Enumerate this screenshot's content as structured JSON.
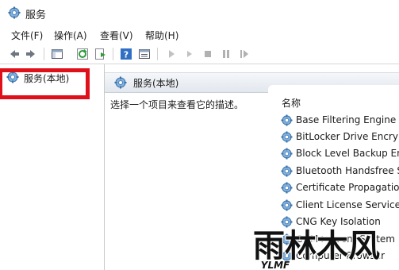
{
  "window": {
    "title": "服务"
  },
  "menu": [
    "文件(F)",
    "操作(A)",
    "查看(V)",
    "帮助(H)"
  ],
  "toolbar": {
    "icons": [
      "back-icon",
      "forward-icon",
      "show-hide-tree-icon",
      "refresh-icon",
      "export-list-icon",
      "help-icon",
      "properties-icon",
      "start-service-icon",
      "start-service-alt-icon",
      "stop-service-icon",
      "pause-service-icon",
      "restart-service-icon"
    ]
  },
  "tree": {
    "root_label": "服务(本地)"
  },
  "main": {
    "header_label": "服务(本地)",
    "description": "选择一个项目来查看它的描述。",
    "column_name": "名称",
    "services": [
      "Base Filtering Engine",
      "BitLocker Drive Encryption Service",
      "Block Level Backup Engine Service",
      "Bluetooth Handsfree Service",
      "Certificate Propagation",
      "Client License Service (ClipSVC)",
      "CNG Key Isolation",
      "COM+ Event System",
      "Computer Browser"
    ]
  },
  "watermark": {
    "text": "雨林木风",
    "subtext": "YLMF"
  },
  "colors": {
    "highlight": "#e0101a",
    "header_bg": "#e2e7ee",
    "gear": "#4a88c8"
  }
}
